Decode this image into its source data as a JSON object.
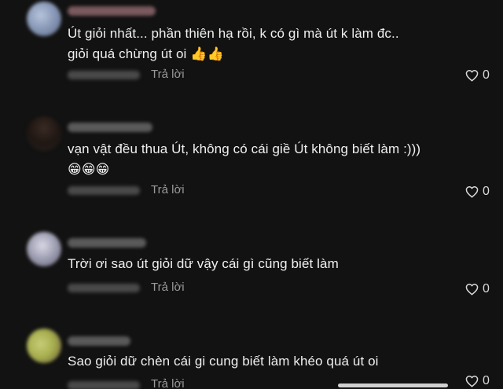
{
  "comments": [
    {
      "text": "Út giỏi nhất... phần thiên hạ rồi, k có gì mà út k làm đc..\ngiỏi quá chừng út oi 👍👍",
      "reply_label": "Trả lời",
      "likes": "0",
      "avatar_color": "#8a9ab8"
    },
    {
      "text": "vạn vật đều thua Út, không có cái giề Út không biết làm :)))\n😁😁😁",
      "reply_label": "Trả lời",
      "likes": "0",
      "avatar_color": "#6b4a3c"
    },
    {
      "text": "Trời ơi sao út giỏi dữ vậy cái gì cũng biết làm",
      "reply_label": "Trả lời",
      "likes": "0",
      "avatar_color": "#9c9cb0"
    },
    {
      "text": "Sao giỏi dữ chèn cái gi cung biết làm khéo quá út oi",
      "reply_label": "Trả lời",
      "likes": "0",
      "avatar_color": "#a8b050"
    }
  ],
  "icons": {
    "like": "heart-outline-icon"
  },
  "colors": {
    "background": "#121212",
    "text": "#f0f0f0",
    "secondary_text": "#9a9a9a"
  }
}
